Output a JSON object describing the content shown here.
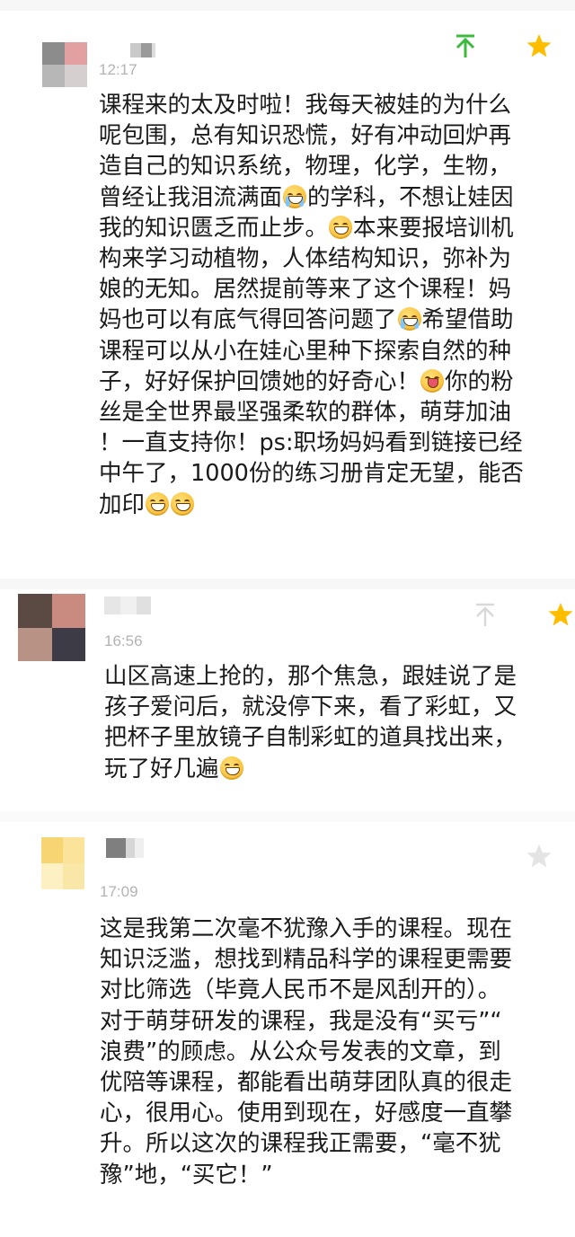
{
  "comments": [
    {
      "time": "12:17",
      "icons": {
        "top": "arrow-to-top-icon",
        "star": "star-icon"
      },
      "top_color": "#3cba3c",
      "star_color": "#ffbd00",
      "text": [
        "课程来的太及时啦！我每天被娃的为什么",
        "呢包围，总有知识恐慌，好有冲动回炉再",
        "造自己的知识系统，物理，化学，生物，",
        "曾经让我泪流满面",
        "的学科，不想让娃因",
        "我的知识匮乏而止步。",
        "本来要报培训机",
        "构来学习动植物，人体结构知识，弥补为",
        "娘的无知。居然提前等来了这个课程！妈",
        "妈也可以有底气得回答问题了",
        "希望借助",
        "课程可以从小在娃心里种下探索自然的种",
        "子，好好保护回馈她的好奇心！",
        "你的粉",
        "丝是全世界最坚强柔软的群体，萌芽加油",
        "！一直支持你！ps:职场妈妈看到链接已经",
        "中午了，1000份的练习册肯定无望，能否",
        "加印"
      ]
    },
    {
      "time": "16:56",
      "icons": {
        "top": "arrow-to-top-icon",
        "star": "star-icon"
      },
      "top_color": "#d9d9d9",
      "star_color": "#ffbd00",
      "text": [
        "山区高速上抢的，那个焦急，跟娃说了是",
        "孩子爱问后，就没停下来，看了彩虹，又",
        "把杯子里放镜子自制彩虹的道具找出来，",
        "玩了好几遍"
      ]
    },
    {
      "time": "17:09",
      "icons": {
        "star": "star-icon"
      },
      "star_color": "#e4e4e4",
      "text": [
        "这是我第二次毫不犹豫入手的课程。现在",
        "知识泛滥，想找到精品科学的课程更需要",
        "对比筛选（毕竟人民币不是风刮开的）。",
        "对于萌芽研发的课程，我是没有“买亏”“",
        "浪费”的顾虑。从公众号发表的文章，到",
        "优陪等课程，都能看出萌芽团队真的很走",
        "心，很用心。使用到现在，好感度一直攀",
        "升。所以这次的课程我正需要，“毫不犹",
        "豫”地，“买它！”"
      ]
    }
  ]
}
